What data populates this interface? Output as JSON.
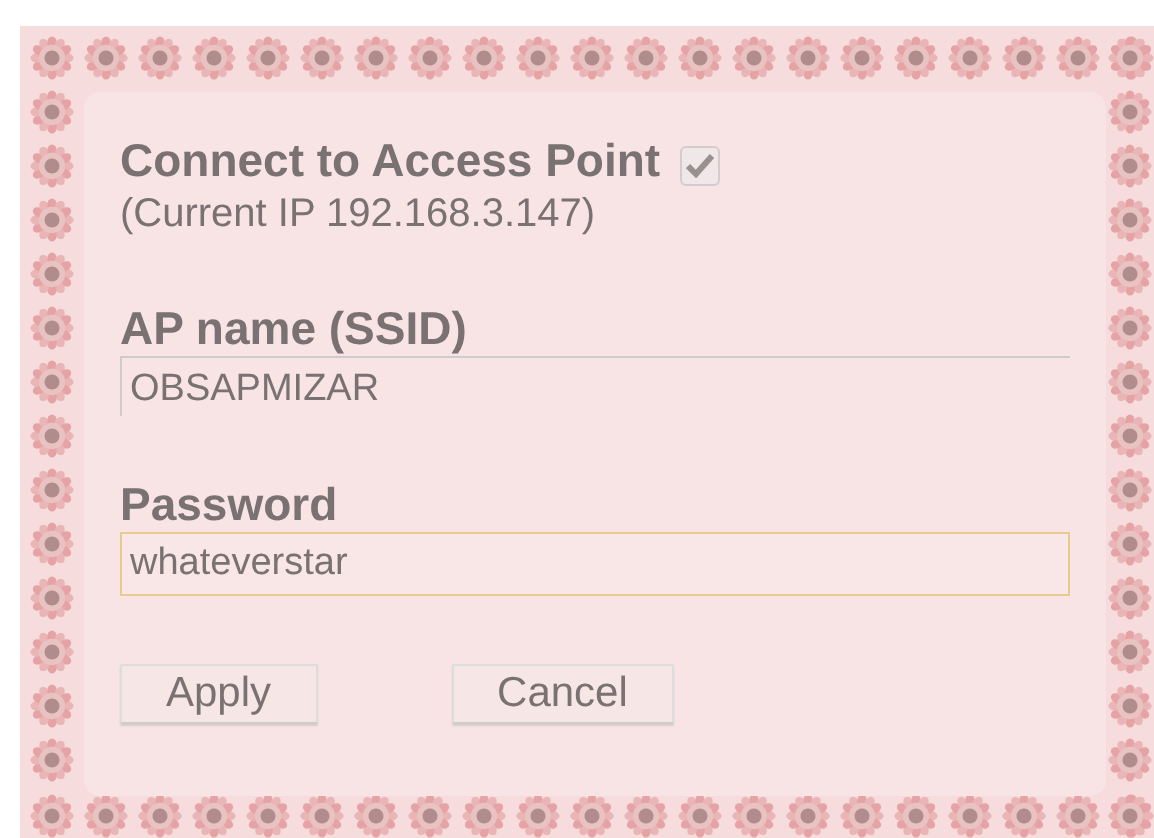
{
  "title": "Connect to Access Point",
  "connect_checkbox": {
    "checked": true
  },
  "current_ip": "(Current IP 192.168.3.147)",
  "fields": [
    {
      "label": "AP name (SSID)",
      "value": "OBSAPMIZAR",
      "focused": false
    },
    {
      "label": "Password",
      "value": "whateverstar",
      "focused": true
    }
  ],
  "buttons": [
    "Apply",
    "Cancel"
  ]
}
